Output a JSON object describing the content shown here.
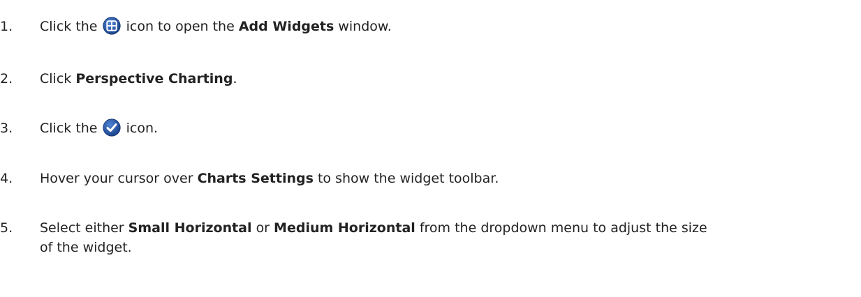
{
  "steps": [
    {
      "number": "1.",
      "pre": "Click the",
      "icon": "add-widget-icon",
      "mid": "icon to open the",
      "bold": "Add Widgets",
      "post": "window."
    },
    {
      "number": "2.",
      "pre": "Click",
      "bold": "Perspective Charting",
      "post": "."
    },
    {
      "number": "3.",
      "pre": "Click the",
      "icon": "checkmark-icon",
      "post": "icon."
    },
    {
      "number": "4.",
      "pre": "Hover your cursor over",
      "bold": "Charts Settings",
      "post": "to show the widget toolbar."
    },
    {
      "number": "5.",
      "pre": "Select either",
      "bold1": "Small Horizontal",
      "mid": "or",
      "bold2": "Medium Horizontal",
      "post_line1": "from the dropdown menu to adjust the size",
      "post_line2": "of the widget."
    }
  ],
  "colors": {
    "text": "#222222",
    "icon_blue": "#1f4f9e",
    "icon_blue_light": "#3a6fc4"
  }
}
